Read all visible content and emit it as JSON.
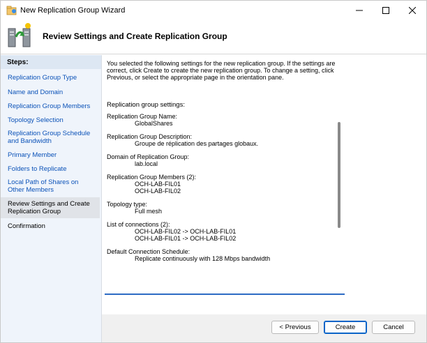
{
  "window": {
    "title": "New Replication Group Wizard",
    "controls": {
      "minimize": "—",
      "maximize": "☐",
      "close": "✕"
    }
  },
  "header": {
    "title": "Review Settings and Create Replication Group",
    "icon": "replication-wizard-icon"
  },
  "steps": {
    "heading": "Steps:",
    "items": [
      {
        "label": "Replication Group Type",
        "state": "link"
      },
      {
        "label": "Name and Domain",
        "state": "link"
      },
      {
        "label": "Replication Group Members",
        "state": "link"
      },
      {
        "label": "Topology Selection",
        "state": "link"
      },
      {
        "label": "Replication Group Schedule and Bandwidth",
        "state": "link"
      },
      {
        "label": "Primary Member",
        "state": "link"
      },
      {
        "label": "Folders to Replicate",
        "state": "link"
      },
      {
        "label": "Local Path of Shares on Other Members",
        "state": "link"
      },
      {
        "label": "Review Settings and Create Replication Group",
        "state": "current"
      },
      {
        "label": "Confirmation",
        "state": "future"
      }
    ]
  },
  "main": {
    "intro": "You selected the following settings for the new replication group. If the settings are correct, click Create to create the new replication group. To change a setting, click Previous, or select the appropriate page in the orientation pane.",
    "settings_label": "Replication group settings:",
    "summary": [
      {
        "label": "Replication Group Name:",
        "values": [
          "GlobalShares"
        ]
      },
      {
        "label": "Replication Group Description:",
        "values": [
          "Groupe de réplication des partages globaux."
        ]
      },
      {
        "label": "Domain of Replication Group:",
        "values": [
          "lab.local"
        ]
      },
      {
        "label": "Replication Group Members (2):",
        "values": [
          "OCH-LAB-FIL01",
          "OCH-LAB-FIL02"
        ]
      },
      {
        "label": "Topology type:",
        "values": [
          "Full mesh"
        ]
      },
      {
        "label": "List of connections (2):",
        "values": [
          "OCH-LAB-FIL02 -> OCH-LAB-FIL01",
          "OCH-LAB-FIL01 -> OCH-LAB-FIL02"
        ]
      },
      {
        "label": "Default Connection Schedule:",
        "values": [
          "Replicate continuously with 128 Mbps bandwidth"
        ]
      }
    ]
  },
  "footer": {
    "previous_label": "< Previous",
    "create_label": "Create",
    "cancel_label": "Cancel"
  },
  "colors": {
    "link": "#0b52b8",
    "accent": "#2d6bc4",
    "steps_bg": "#eff4fb",
    "footer_bg": "#f0f0f0"
  }
}
